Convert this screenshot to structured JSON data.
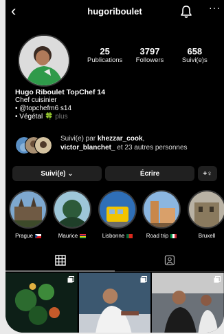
{
  "header": {
    "back_icon": "back-chevron-icon",
    "username": "hugoriboulet",
    "bell_icon": "bell-icon",
    "more_icon": "more-icon",
    "more_glyph": "···"
  },
  "profile": {
    "stats": [
      {
        "value": "25",
        "label": "Publications"
      },
      {
        "value": "3797",
        "label": "Followers"
      },
      {
        "value": "658",
        "label": "Suivi(e)s"
      }
    ]
  },
  "bio": {
    "name": "Hugo Riboulet TopChef 14",
    "category": "Chef cuisinier",
    "line1": "• @topchefm6 s14",
    "line2_text": "• Végétal",
    "line2_emoji": "🍀",
    "more": "plus"
  },
  "followed_by": {
    "prefix": "Suivi(e) par",
    "user1": "khezzar_cook",
    "user2": "victor_blanchet_",
    "suffix": " et 23 autres personnes"
  },
  "actions": {
    "following_label": "Suivi(e) ⌄",
    "message_label": "Écrire",
    "add_user_glyph": "+♀"
  },
  "highlights": [
    {
      "label": "Prague",
      "flag": "czech"
    },
    {
      "label": "Maurice",
      "flag": "mauritius"
    },
    {
      "label": "Lisbonne",
      "flag": "portugal"
    },
    {
      "label": "Road trip",
      "flag": "italy"
    },
    {
      "label": "Bruxell",
      "flag": ""
    }
  ],
  "tabs": [
    {
      "name": "grid-tab",
      "icon": "grid-icon",
      "active": true
    },
    {
      "name": "tagged-tab",
      "icon": "tagged-person-icon",
      "active": false
    }
  ],
  "colors": {
    "background": "#000000",
    "button": "#202020",
    "muted": "#777777",
    "leaf": "#4fb34f"
  }
}
